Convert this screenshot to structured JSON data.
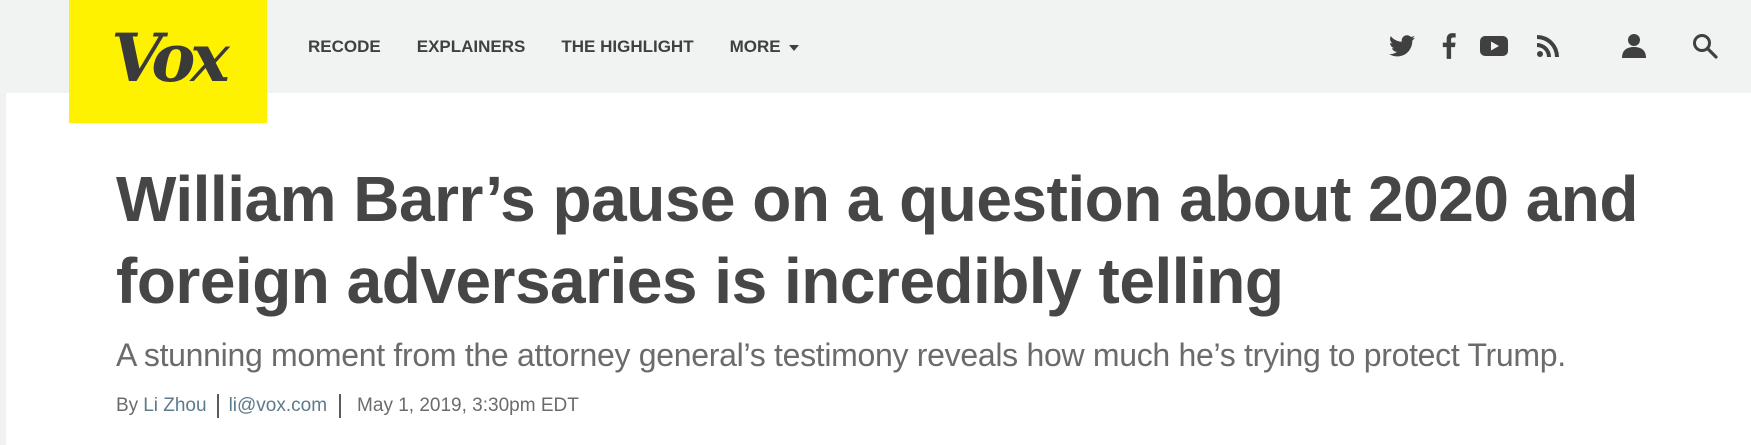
{
  "site": {
    "logo_text": "Vox",
    "brand_color": "#fff200"
  },
  "nav": {
    "items": [
      {
        "label": "RECODE"
      },
      {
        "label": "EXPLAINERS"
      },
      {
        "label": "THE HIGHLIGHT"
      },
      {
        "label": "MORE"
      }
    ]
  },
  "header_icons": [
    "twitter-icon",
    "facebook-icon",
    "youtube-icon",
    "rss-icon",
    "user-icon",
    "search-icon"
  ],
  "article": {
    "headline": "William Barr’s pause on a question about 2020 and foreign adversaries is incredibly telling",
    "dek": "A stunning moment from the attorney general’s testimony reveals how much he’s trying to protect Trump.",
    "byline": {
      "by": "By",
      "author": "Li Zhou",
      "email": "li@vox.com",
      "date": "May 1, 2019, 3:30pm EDT"
    }
  }
}
